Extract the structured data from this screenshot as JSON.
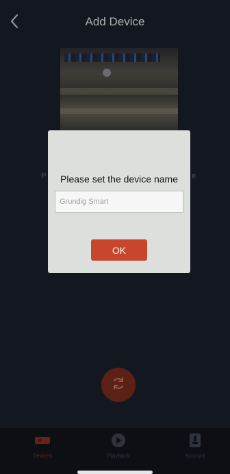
{
  "header": {
    "title": "Add Device",
    "back_icon": "chevron-left-icon"
  },
  "background_hint": {
    "left_fragment": "P",
    "right_fragment": "e"
  },
  "dialog": {
    "title": "Please set the device name",
    "input": {
      "placeholder": "Grundig Smart",
      "value": ""
    },
    "ok_label": "OK"
  },
  "refresh_button": {
    "icon": "refresh-icon"
  },
  "tabbar": {
    "tabs": [
      {
        "label": "Devices",
        "icon": "camera-device-icon",
        "active": true
      },
      {
        "label": "Playback",
        "icon": "play-circle-icon",
        "active": false
      },
      {
        "label": "Account",
        "icon": "account-icon",
        "active": false
      }
    ]
  },
  "colors": {
    "background": "#1a1f2b",
    "accent": "#c8472c",
    "dialog_bg": "#dcdfdc"
  }
}
